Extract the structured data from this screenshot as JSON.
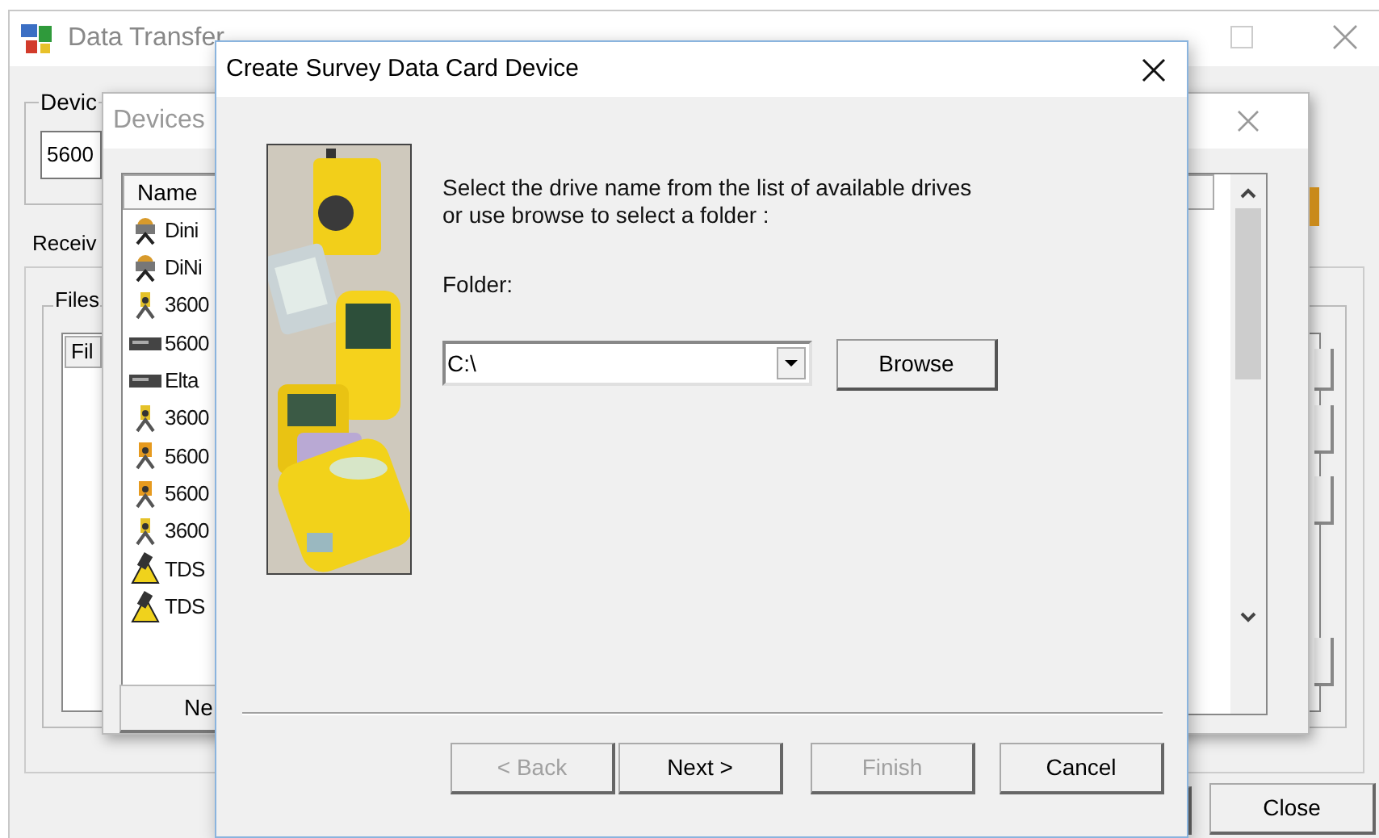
{
  "main_window": {
    "title": "Data Transfer",
    "device_label": "Devic",
    "device_value": "5600",
    "tab": "Receiv",
    "files_label": "Files",
    "files_column": "Fil",
    "close_button": "Close"
  },
  "devices_window": {
    "title": "Devices",
    "column": "Name",
    "new_button": "Ne",
    "items": [
      {
        "name": "Dini",
        "kind": "level"
      },
      {
        "name": "DiNi",
        "kind": "level"
      },
      {
        "name": "3600",
        "kind": "station"
      },
      {
        "name": "5600",
        "kind": "card"
      },
      {
        "name": "Elta",
        "kind": "card"
      },
      {
        "name": "3600",
        "kind": "station"
      },
      {
        "name": "5600",
        "kind": "robot"
      },
      {
        "name": "5600",
        "kind": "robot"
      },
      {
        "name": "3600",
        "kind": "station"
      },
      {
        "name": "TDS",
        "kind": "handheld"
      },
      {
        "name": "TDS",
        "kind": "handheld"
      }
    ]
  },
  "dialog": {
    "title": "Create Survey Data Card Device",
    "instruction": "Select the drive name from the list of available drives\nor use browse to select a folder :",
    "folder_label": "Folder:",
    "folder_value": "C:\\",
    "browse_button": "Browse",
    "wizard_buttons": [
      {
        "label": "< Back",
        "disabled": true
      },
      {
        "label": "Next >",
        "disabled": false
      },
      {
        "label": "Finish",
        "disabled": true
      },
      {
        "label": "Cancel",
        "disabled": false
      }
    ]
  }
}
